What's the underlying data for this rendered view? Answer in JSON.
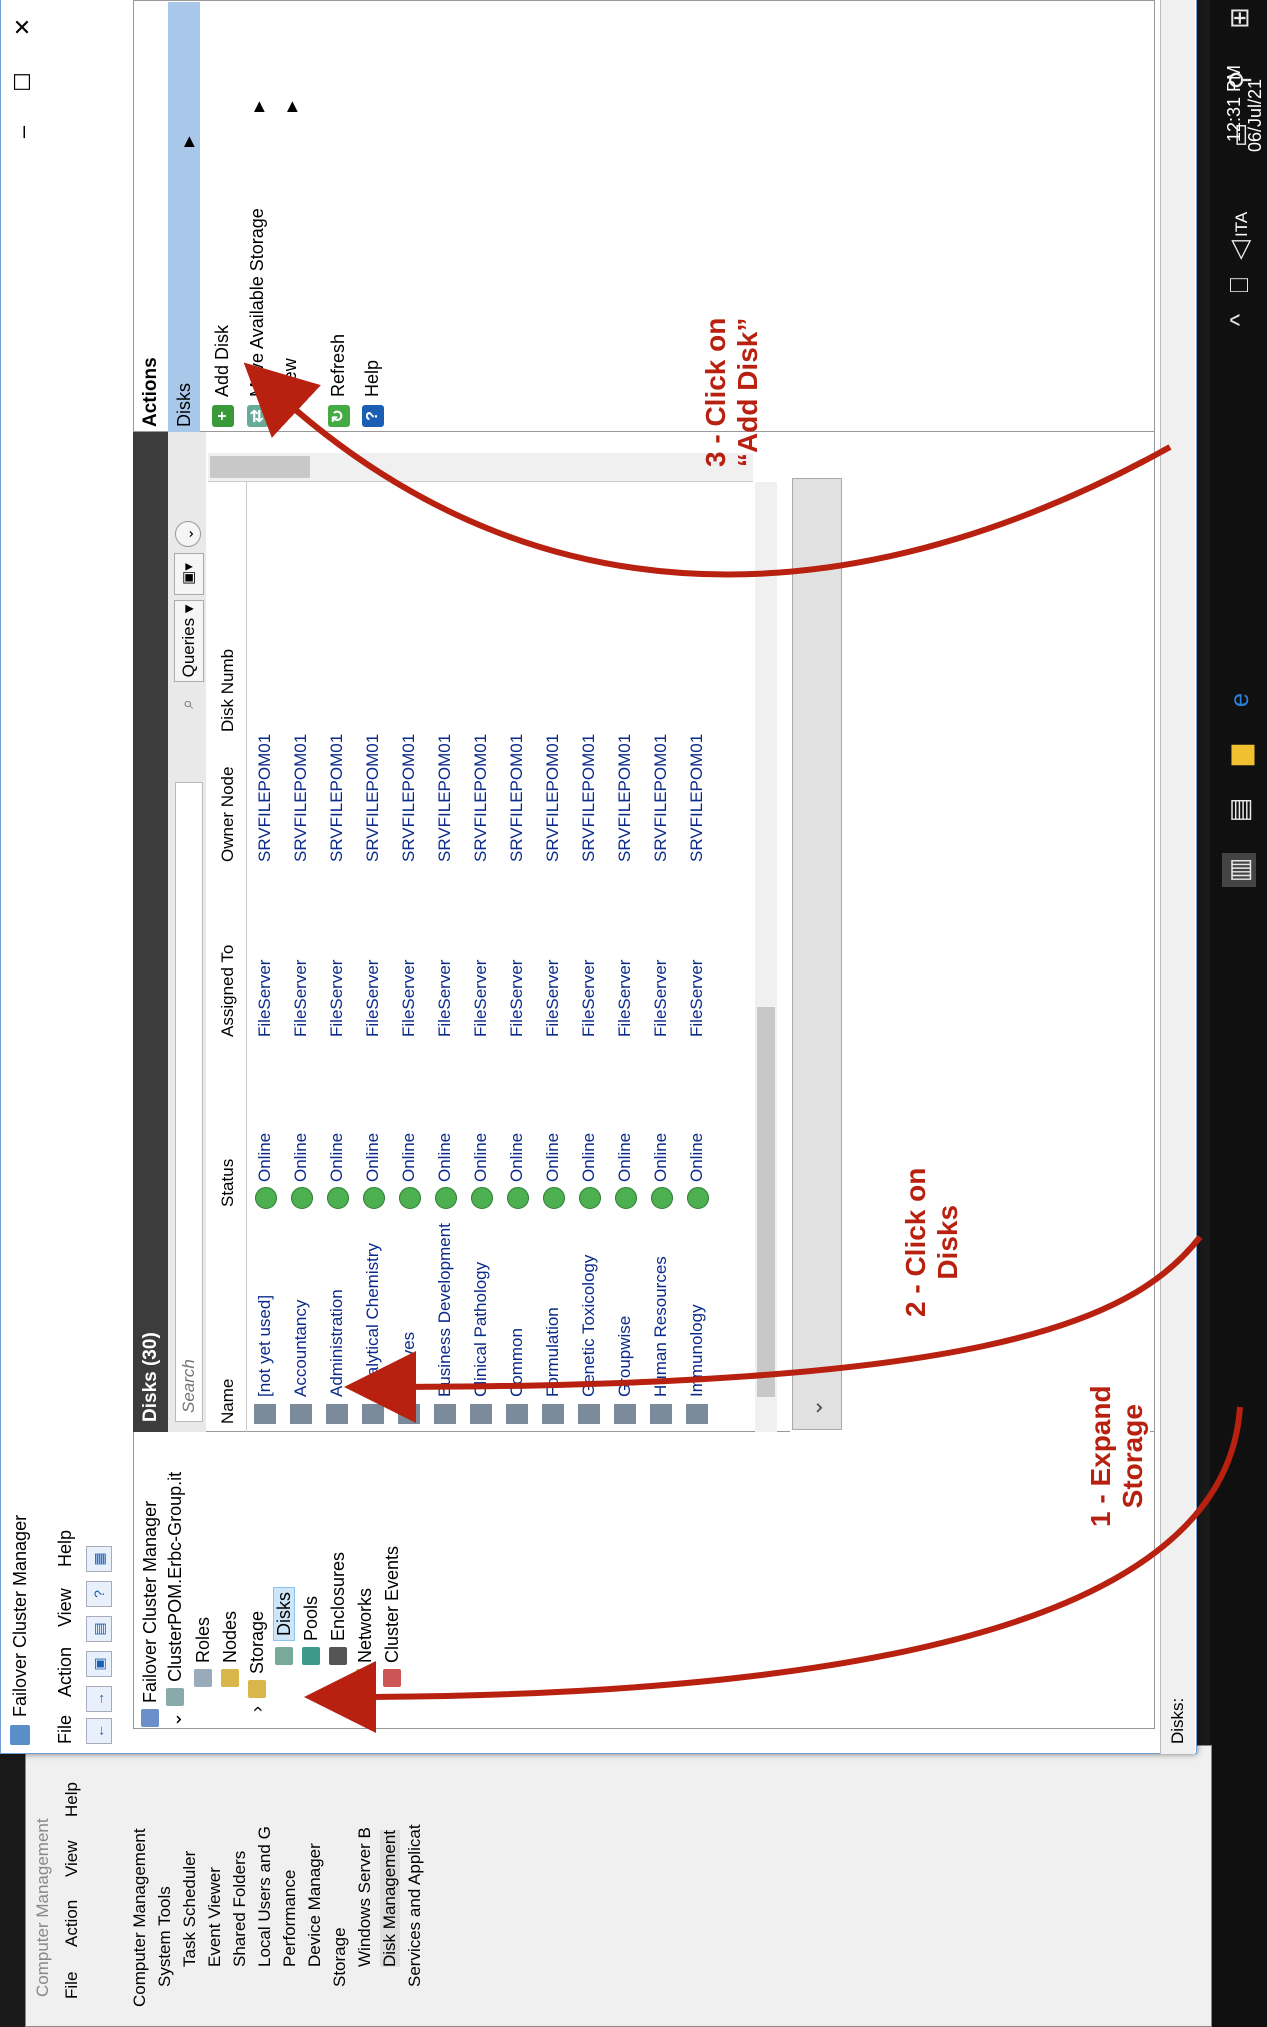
{
  "taskbar": {
    "clock_time": "12:31 PM",
    "clock_date": "06/Jul/21",
    "language": "ITA"
  },
  "back_window": {
    "title": "Computer Management",
    "menu": [
      "File",
      "Action",
      "View",
      "Help"
    ],
    "tree": [
      "Computer Management",
      "System Tools",
      "Task Scheduler",
      "Event Viewer",
      "Shared Folders",
      "Local Users and G",
      "Performance",
      "Device Manager",
      "Storage",
      "Windows Server B",
      "Disk Management",
      "Services and Applicat"
    ]
  },
  "window": {
    "title": "Failover Cluster Manager",
    "menu": [
      "File",
      "Action",
      "View",
      "Help"
    ]
  },
  "nav": {
    "root": "Failover Cluster Manager",
    "cluster": "ClusterPOM.Erbc-Group.it",
    "roles": "Roles",
    "nodes": "Nodes",
    "storage": "Storage",
    "disks": "Disks",
    "pools": "Pools",
    "enclosures": "Enclosures",
    "networks": "Networks",
    "cluster_events": "Cluster Events"
  },
  "center": {
    "title": "Disks (30)",
    "search_placeholder": "Search",
    "queries_label": "Queries",
    "columns": [
      "Name",
      "Status",
      "Assigned To",
      "Owner Node",
      "Disk Numb"
    ],
    "rows": [
      {
        "name": "[not yet used]",
        "status": "Online",
        "assigned": "FileServer",
        "owner": "SRVFILEPOM01"
      },
      {
        "name": "Accountancy",
        "status": "Online",
        "assigned": "FileServer",
        "owner": "SRVFILEPOM01"
      },
      {
        "name": "Administration",
        "status": "Online",
        "assigned": "FileServer",
        "owner": "SRVFILEPOM01"
      },
      {
        "name": "Analytical Chemistry",
        "status": "Online",
        "assigned": "FileServer",
        "owner": "SRVFILEPOM01"
      },
      {
        "name": "Archives",
        "status": "Online",
        "assigned": "FileServer",
        "owner": "SRVFILEPOM01"
      },
      {
        "name": "Business Development",
        "status": "Online",
        "assigned": "FileServer",
        "owner": "SRVFILEPOM01"
      },
      {
        "name": "Clinical Pathology",
        "status": "Online",
        "assigned": "FileServer",
        "owner": "SRVFILEPOM01"
      },
      {
        "name": "Common",
        "status": "Online",
        "assigned": "FileServer",
        "owner": "SRVFILEPOM01"
      },
      {
        "name": "Formulation",
        "status": "Online",
        "assigned": "FileServer",
        "owner": "SRVFILEPOM01"
      },
      {
        "name": "Genetic Toxicology",
        "status": "Online",
        "assigned": "FileServer",
        "owner": "SRVFILEPOM01"
      },
      {
        "name": "Groupwise",
        "status": "Online",
        "assigned": "FileServer",
        "owner": "SRVFILEPOM01"
      },
      {
        "name": "Human Resources",
        "status": "Online",
        "assigned": "FileServer",
        "owner": "SRVFILEPOM01"
      },
      {
        "name": "Immunology",
        "status": "Online",
        "assigned": "FileServer",
        "owner": "SRVFILEPOM01"
      }
    ]
  },
  "actions": {
    "title": "Actions",
    "section": "Disks",
    "add_disk": "Add Disk",
    "move_storage": "Move Available Storage",
    "view": "View",
    "refresh": "Refresh",
    "help": "Help"
  },
  "status_bar": "Disks:",
  "annotations": {
    "step1_line1": "1 - Expand",
    "step1_line2": "Storage",
    "step2_line1": "2 - Click on",
    "step2_line2": "Disks",
    "step3_line1": "3 - Click on",
    "step3_line2": "“Add Disk”"
  },
  "colors": {
    "annotation": "#b8200f",
    "header_dark": "#3c3c3c",
    "selection": "#cde5f7",
    "actions_band": "#a9c7e8"
  }
}
